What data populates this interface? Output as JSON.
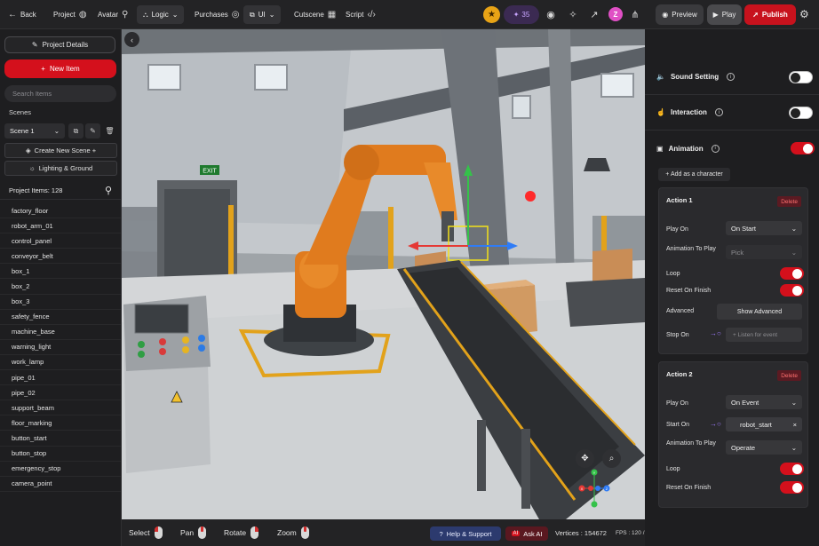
{
  "topbar": {
    "back_label": "Back",
    "project_label": "Project",
    "avatar_label": "Avatar",
    "logic_label": "Logic",
    "purchases_label": "Purchases",
    "ui_label": "UI",
    "cutscene_label": "Cutscene",
    "script_label": "Script",
    "credits": "35",
    "avatar_initial": "Z",
    "preview_label": "Preview",
    "play_label": "Play",
    "publish_label": "Publish"
  },
  "left": {
    "project_details_label": "Project Details",
    "new_item_label": "New Item",
    "search_placeholder": "Search Items",
    "scenes_label": "Scenes",
    "scene_selected": "Scene 1",
    "create_scene_label": "Create New Scene +",
    "lighting_label": "Lighting & Ground",
    "project_items_label": "Project Items: 128",
    "items": [
      "factory_floor",
      "robot_arm_01",
      "control_panel",
      "conveyor_belt",
      "box_1",
      "box_2",
      "box_3",
      "safety_fence",
      "machine_base",
      "warning_light",
      "work_lamp",
      "pipe_01",
      "pipe_02",
      "support_beam",
      "floor_marking",
      "button_start",
      "button_stop",
      "emergency_stop",
      "camera_point"
    ]
  },
  "viewport": {
    "exit_sign": "EXIT",
    "gizmo_labels": {
      "y": "Y",
      "x": "X",
      "z": "Z"
    }
  },
  "bottom": {
    "select_label": "Select",
    "pan_label": "Pan",
    "rotate_label": "Rotate",
    "zoom_label": "Zoom",
    "help_label": "Help & Support",
    "ai_tag": "AI",
    "ask_ai_label": "Ask AI",
    "vertices_label": "Vertices : 154672",
    "stats_label": "FPS : 120 / DrawCalls : 312"
  },
  "right": {
    "sound_label": "Sound Setting",
    "interaction_label": "Interaction",
    "animation_label": "Animation",
    "add_character_label": "+ Add as a character",
    "action1": {
      "title": "Action 1",
      "delete_label": "Delete",
      "play_on_label": "Play On",
      "play_on_value": "On Start",
      "anim_to_play_label": "Animation To Play",
      "anim_value": "Pick",
      "loop_label": "Loop",
      "reset_label": "Reset On Finish",
      "advanced_label": "Advanced",
      "show_advanced_label": "Show Advanced",
      "stop_on_label": "Stop On",
      "listen_placeholder": "+ Listen for event"
    },
    "action2": {
      "title": "Action 2",
      "delete_label": "Delete",
      "play_on_label": "Play On",
      "play_on_value": "On Event",
      "start_on_label": "Start On",
      "start_on_value": "robot_start",
      "anim_to_play_label": "Animation To Play",
      "anim_value": "Operate",
      "loop_label": "Loop",
      "reset_label": "Reset On Finish"
    }
  },
  "colors": {
    "accent_red": "#d4101c",
    "panel_bg": "#1e1e20",
    "credit_purple": "#c9a6ff"
  }
}
